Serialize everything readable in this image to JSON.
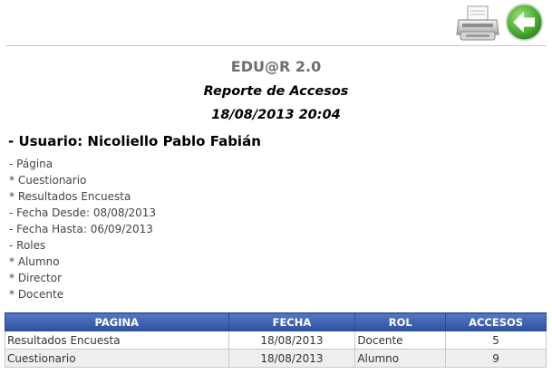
{
  "toolbar": {
    "print_icon": "printer-icon",
    "back_icon": "back-arrow-icon",
    "back_color": "#4caf33"
  },
  "header": {
    "app_title": "EDU@R 2.0",
    "report_title": "Reporte de Accesos",
    "report_datetime": "18/08/2013 20:04"
  },
  "user": {
    "line": "- Usuario: Nicoliello Pablo Fabián"
  },
  "filters": [
    "- Página",
    "* Cuestionario",
    "* Resultados Encuesta",
    "- Fecha Desde: 08/08/2013",
    "- Fecha Hasta: 06/09/2013",
    "- Roles",
    "* Alumno",
    "* Director",
    "* Docente"
  ],
  "table": {
    "headers": [
      "PAGINA",
      "FECHA",
      "ROL",
      "ACCESOS"
    ],
    "header_color": "#3e62b0",
    "rows": [
      {
        "pagina": "Resultados Encuesta",
        "fecha": "18/08/2013",
        "rol": "Docente",
        "accesos": "5"
      },
      {
        "pagina": "Cuestionario",
        "fecha": "18/08/2013",
        "rol": "Alumno",
        "accesos": "9"
      }
    ]
  }
}
